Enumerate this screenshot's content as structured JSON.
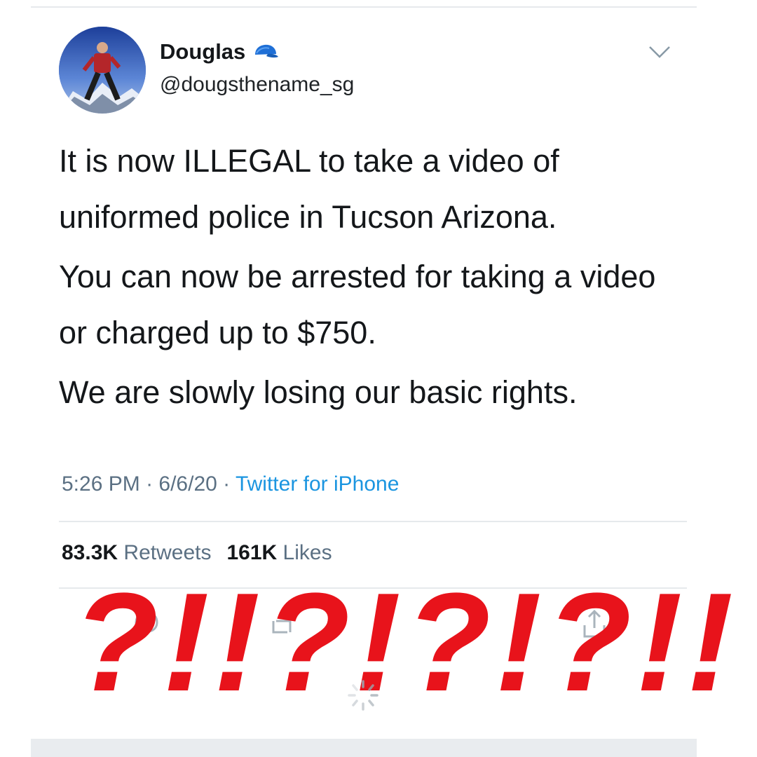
{
  "user": {
    "display_name": "Douglas",
    "handle": "@dougsthename_sg",
    "badge_icon": "blue-cap-icon"
  },
  "tweet": {
    "paragraphs": [
      "It is now ILLEGAL to take a video of uniformed police in Tucson Arizona.",
      "You can now be arrested for taking a video or charged up to $750.",
      "We are slowly losing our basic rights."
    ],
    "time": "5:26 PM",
    "date": "6/6/20",
    "source": "Twitter for iPhone"
  },
  "stats": {
    "retweets_count": "83.3K",
    "retweets_label": "Retweets",
    "likes_count": "161K",
    "likes_label": "Likes"
  },
  "overlay": {
    "punctuation": "?!!?!?!?!!",
    "color": "#e8131b"
  },
  "colors": {
    "link_blue": "#1b95e0",
    "secondary_gray": "#5b7083"
  }
}
